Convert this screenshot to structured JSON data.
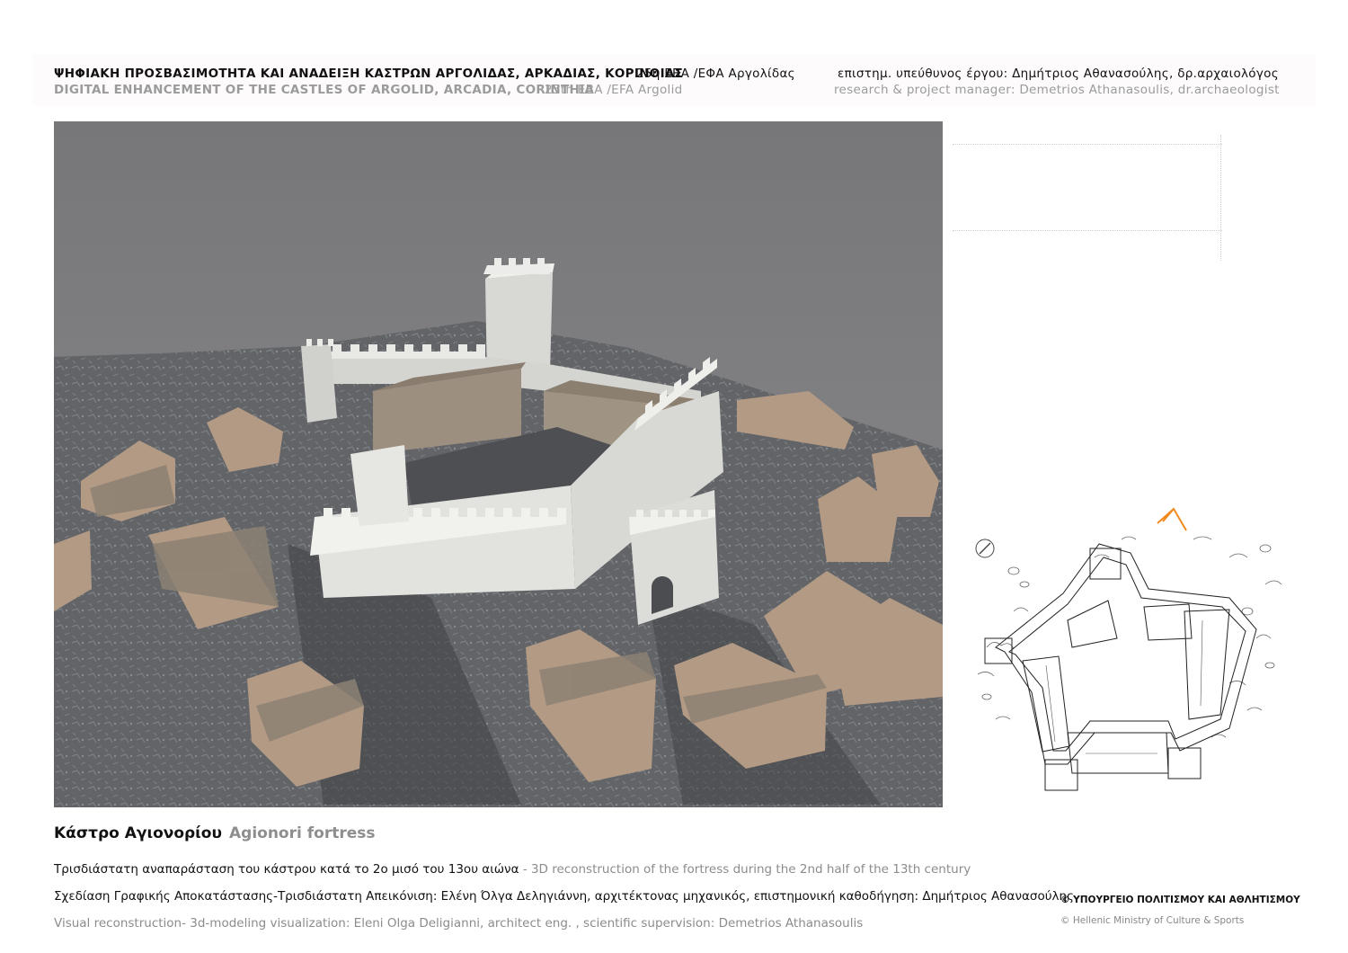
{
  "header": {
    "project_gr": "ΨΗΦΙΑΚΗ ΠΡΟΣΒΑΣΙΜΟΤΗΤΑ ΚΑΙ ΑΝΑΔΕΙΞΗ ΚΑΣΤΡΩΝ ΑΡΓΟΛΙΔΑΣ, ΑΡΚΑΔΙΑΣ, ΚΟΡΙΝΘΙΑΣ",
    "project_en": "DIGITAL ENHANCEMENT OF THE CASTLES OF ARGOLID, ARCADIA, CORINTHIA",
    "ephorate_gr": "25η ΕΒΑ /ΕΦΑ Αργολίδας",
    "ephorate_en": "25th EBA /EFA Argolid",
    "manager_gr": "επιστημ. υπεύθυνος έργου: Δημήτριος Αθανασούλης, δρ.αρχαιολόγος",
    "manager_en": "research & project manager: Demetrios Athanasoulis, dr.archaeologist"
  },
  "title": {
    "gr": "Κάστρο Αγιονορίου",
    "en": "Agionori fortress"
  },
  "captions": {
    "line1_gr": "Τρισδιάστατη αναπαράσταση του κάστρου κατά το 2ο μισό του 13ου αιώνα",
    "line1_en": " - 3D reconstruction of the fortress during the 2nd half of the 13th century",
    "line2_gr": "Σχεδίαση Γραφικής Αποκατάστασης-Τρισδιάστατη Απεικόνιση: Ελένη Όλγα Δεληγιάννη, αρχιτέκτονας μηχανικός, επιστημονική καθοδήγηση: Δημήτριος Αθανασούλης",
    "line3_en": "Visual reconstruction- 3d-modeling visualization: Eleni Olga Deligianni, architect eng. , scientific supervision: Demetrios Athanasoulis"
  },
  "ministry": {
    "gr": "© ΥΠΟΥΡΓΕΙΟ ΠΟΛΙΤΙΣΜΟΥ  ΚΑΙ ΑΘΛΗΤΙΣΜΟΥ",
    "en": "© Hellenic Ministry of Culture  & Sports"
  },
  "colors": {
    "sky": "#7b7b7d",
    "ground": "#5b5d61",
    "wall": "#dcdcd8",
    "roof": "#b49b85",
    "north_arrow": "#f08a1c"
  }
}
